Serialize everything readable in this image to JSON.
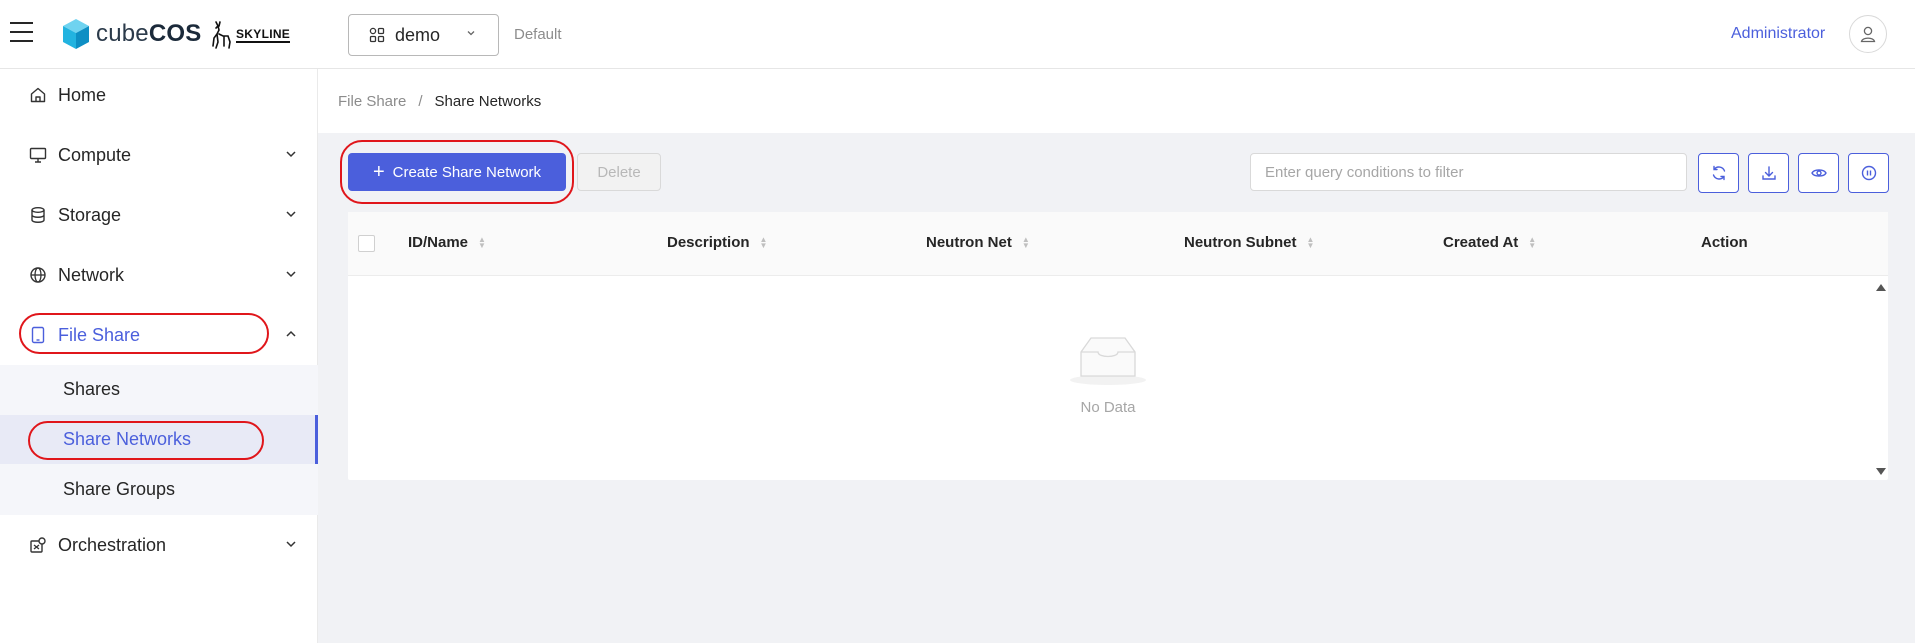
{
  "header": {
    "brand_prefix": "cube",
    "brand_suffix": "COS",
    "partner_logo": "SKYLINE",
    "project": "demo",
    "domain": "Default",
    "user": "Administrator"
  },
  "sidebar": {
    "items": [
      {
        "label": "Home",
        "icon": "home-icon"
      },
      {
        "label": "Compute",
        "icon": "monitor-icon"
      },
      {
        "label": "Storage",
        "icon": "database-icon"
      },
      {
        "label": "Network",
        "icon": "globe-icon"
      },
      {
        "label": "File Share",
        "icon": "tablet-icon"
      },
      {
        "label": "Orchestration",
        "icon": "orchestration-icon"
      }
    ],
    "file_share_children": [
      {
        "label": "Shares"
      },
      {
        "label": "Share Networks"
      },
      {
        "label": "Share Groups"
      }
    ]
  },
  "breadcrumb": {
    "parent": "File Share",
    "separator": "/",
    "current": "Share Networks"
  },
  "toolbar": {
    "create_label": "Create Share Network",
    "delete_label": "Delete",
    "filter_placeholder": "Enter query conditions to filter"
  },
  "table": {
    "columns": [
      "ID/Name",
      "Description",
      "Neutron Net",
      "Neutron Subnet",
      "Created At",
      "Action"
    ],
    "empty_text": "No Data"
  },
  "colors": {
    "accent": "#4b5fdc",
    "highlight_ring": "#e0161b"
  }
}
